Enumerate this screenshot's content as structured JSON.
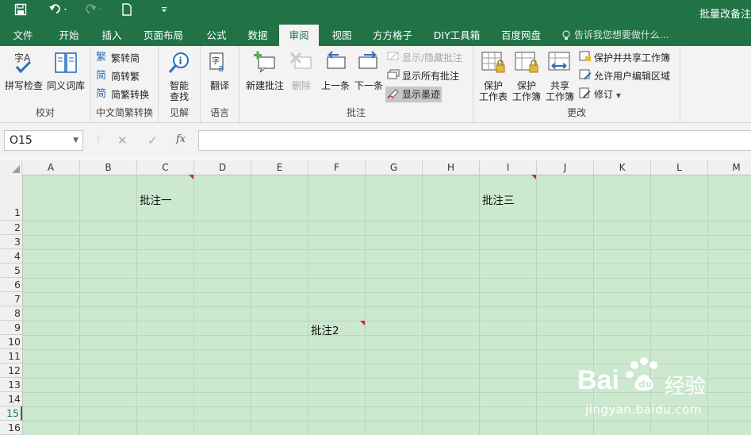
{
  "quick_access": {
    "save_icon": "save-icon",
    "undo_icon": "undo-icon",
    "redo_icon": "redo-icon",
    "new_icon": "new-file-icon",
    "customize_icon": "customize-qat-icon"
  },
  "window": {
    "title": "批量改备注"
  },
  "tabs": [
    {
      "label": "文件",
      "active": false
    },
    {
      "label": "开始",
      "active": false
    },
    {
      "label": "插入",
      "active": false
    },
    {
      "label": "页面布局",
      "active": false
    },
    {
      "label": "公式",
      "active": false
    },
    {
      "label": "数据",
      "active": false
    },
    {
      "label": "审阅",
      "active": true
    },
    {
      "label": "视图",
      "active": false
    },
    {
      "label": "方方格子",
      "active": false
    },
    {
      "label": "DIY工具箱",
      "active": false
    },
    {
      "label": "百度网盘",
      "active": false
    }
  ],
  "tell_me": "告诉我您想要做什么...",
  "ribbon": {
    "proofing": {
      "label": "校对",
      "spell": "拼写检查",
      "thesaurus": "同义词库"
    },
    "chinese": {
      "label": "中文简繁转换",
      "to_simplified": "繁转简",
      "to_traditional": "简转繁",
      "convert": "简繁转换"
    },
    "insights": {
      "label": "见解",
      "smart_lookup_1": "智能",
      "smart_lookup_2": "查找"
    },
    "language": {
      "label": "语言",
      "translate": "翻译"
    },
    "comments": {
      "label": "批注",
      "new": "新建批注",
      "delete": "删除",
      "prev": "上一条",
      "next": "下一条",
      "show_hide": "显示/隐藏批注",
      "show_all": "显示所有批注",
      "show_ink": "显示墨迹"
    },
    "changes": {
      "label": "更改",
      "protect_sheet_1": "保护",
      "protect_sheet_2": "工作表",
      "protect_wb_1": "保护",
      "protect_wb_2": "工作簿",
      "share_wb_1": "共享",
      "share_wb_2": "工作簿",
      "protect_share": "保护并共享工作簿",
      "allow_edit": "允许用户编辑区域",
      "track": "修订"
    }
  },
  "formula_bar": {
    "name_box": "O15",
    "cancel": "✕",
    "enter": "✓",
    "fx": "fx",
    "value": ""
  },
  "columns": [
    "A",
    "B",
    "C",
    "D",
    "E",
    "F",
    "G",
    "H",
    "I",
    "J",
    "K",
    "L",
    "M"
  ],
  "rows": [
    "1",
    "2",
    "3",
    "4",
    "5",
    "6",
    "7",
    "8",
    "9",
    "10",
    "11",
    "12",
    "13",
    "14",
    "15",
    "16"
  ],
  "cells": {
    "c1": "批注一",
    "i1": "批注三",
    "f9": "批注2"
  },
  "watermark": {
    "brand": "Bai",
    "brand2": "经验",
    "url": "jingyan.baidu.com"
  }
}
